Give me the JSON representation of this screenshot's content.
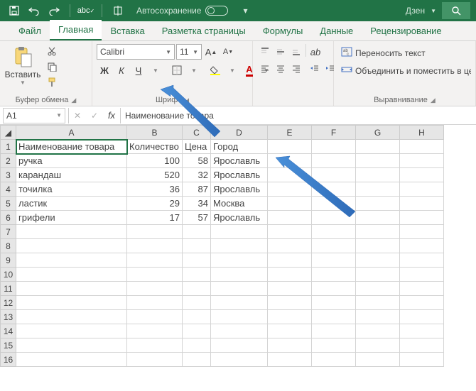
{
  "titlebar": {
    "autosave_label": "Автосохранение",
    "user_label": "Дзен"
  },
  "tabs": {
    "file": "Файл",
    "home": "Главная",
    "insert": "Вставка",
    "layout": "Разметка страницы",
    "formulas": "Формулы",
    "data": "Данные",
    "review": "Рецензирование"
  },
  "ribbon": {
    "clipboard": {
      "paste": "Вставить",
      "label": "Буфер обмена"
    },
    "font": {
      "name": "Calibri",
      "size": "11",
      "bold": "Ж",
      "italic": "К",
      "underline": "Ч",
      "label": "Шрифт"
    },
    "align": {
      "label": "Выравнивание"
    },
    "wrap": {
      "wrap_text": "Переносить текст",
      "merge": "Объединить и поместить в центр"
    }
  },
  "namebar": {
    "cell": "A1",
    "fx": "fx",
    "formula": "Наименование товара"
  },
  "columns": [
    "A",
    "B",
    "C",
    "D",
    "E",
    "F",
    "G",
    "H"
  ],
  "rows": [
    "1",
    "2",
    "3",
    "4",
    "5",
    "6",
    "7",
    "8",
    "9",
    "10",
    "11",
    "12",
    "13",
    "14",
    "15",
    "16"
  ],
  "headers": {
    "c0": "Наименование товара",
    "c1": "Количество",
    "c2": "Цена",
    "c3": "Город"
  },
  "data_rows": [
    {
      "name": "ручка",
      "qty": "100",
      "price": "58",
      "city": "Ярославль"
    },
    {
      "name": "карандаш",
      "qty": "520",
      "price": "32",
      "city": "Ярославль"
    },
    {
      "name": "точилка",
      "qty": "36",
      "price": "87",
      "city": "Ярославль"
    },
    {
      "name": "ластик",
      "qty": "29",
      "price": "34",
      "city": "Москва"
    },
    {
      "name": "грифели",
      "qty": "17",
      "price": "57",
      "city": "Ярославль"
    }
  ],
  "chart_data": {
    "type": "table",
    "columns": [
      "Наименование товара",
      "Количество",
      "Цена",
      "Город"
    ],
    "rows": [
      [
        "ручка",
        100,
        58,
        "Ярославль"
      ],
      [
        "карандаш",
        520,
        32,
        "Ярославль"
      ],
      [
        "точилка",
        36,
        87,
        "Ярославль"
      ],
      [
        "ластик",
        29,
        34,
        "Москва"
      ],
      [
        "грифели",
        17,
        57,
        "Ярославль"
      ]
    ]
  }
}
